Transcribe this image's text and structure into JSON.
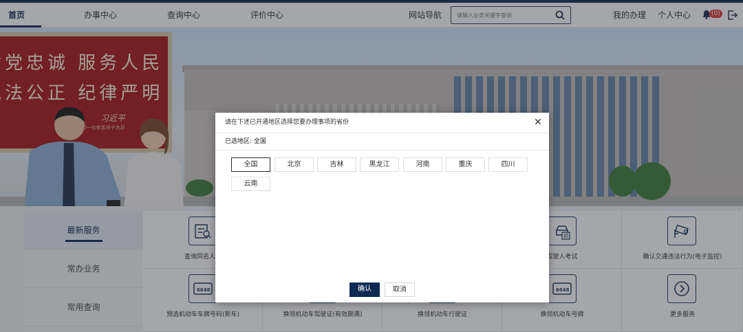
{
  "nav": {
    "items": [
      {
        "label": "首页",
        "active": true
      },
      {
        "label": "办事中心"
      },
      {
        "label": "查询中心"
      },
      {
        "label": "评价中心"
      },
      {
        "label": "网站导航"
      }
    ],
    "search_placeholder": "请输入业务关键字查询",
    "my_business": "我的办理",
    "personal_center": "个人中心",
    "notification_count": "(0)"
  },
  "hero": {
    "slogan_line1": "对党忠诚  服务人民",
    "slogan_line2": "执法公正  纪律严明",
    "signature": "习近平",
    "signature_date": "二〇一七年五月十九日"
  },
  "services": {
    "tabs": [
      {
        "label": "最新服务",
        "active": true
      },
      {
        "label": "常办业务"
      },
      {
        "label": "常用查询"
      }
    ],
    "cells": [
      {
        "label": "查询同名人数",
        "icon": "id-card-search-icon"
      },
      {
        "label": "",
        "icon": ""
      },
      {
        "label": "",
        "icon": ""
      },
      {
        "label": "驾驶人考试",
        "icon": "car-exam-icon"
      },
      {
        "label": "确认交通违法行为(电子监控)",
        "icon": "traffic-camera-icon"
      },
      {
        "label": "预选机动车车牌号码(新车)",
        "icon": "license-plate-icon"
      },
      {
        "label": "换领机动车驾驶证(有效期满)",
        "icon": "license-card-icon"
      },
      {
        "label": "换领机动车行驶证",
        "icon": "registration-icon"
      },
      {
        "label": "换领机动车号牌",
        "icon": "license-plate-icon"
      },
      {
        "label": "更多服务",
        "icon": "arrow-right-circle-icon"
      }
    ],
    "plate_text": "6648"
  },
  "modal": {
    "title": "请在下述已开通地区选择您要办理事项的省份",
    "selected_prefix": "已选地区: ",
    "selected_region": "全国",
    "regions": [
      "全国",
      "北京",
      "吉林",
      "黑龙江",
      "河南",
      "重庆",
      "四川",
      "云南"
    ],
    "confirm_label": "确认",
    "cancel_label": "取消"
  }
}
